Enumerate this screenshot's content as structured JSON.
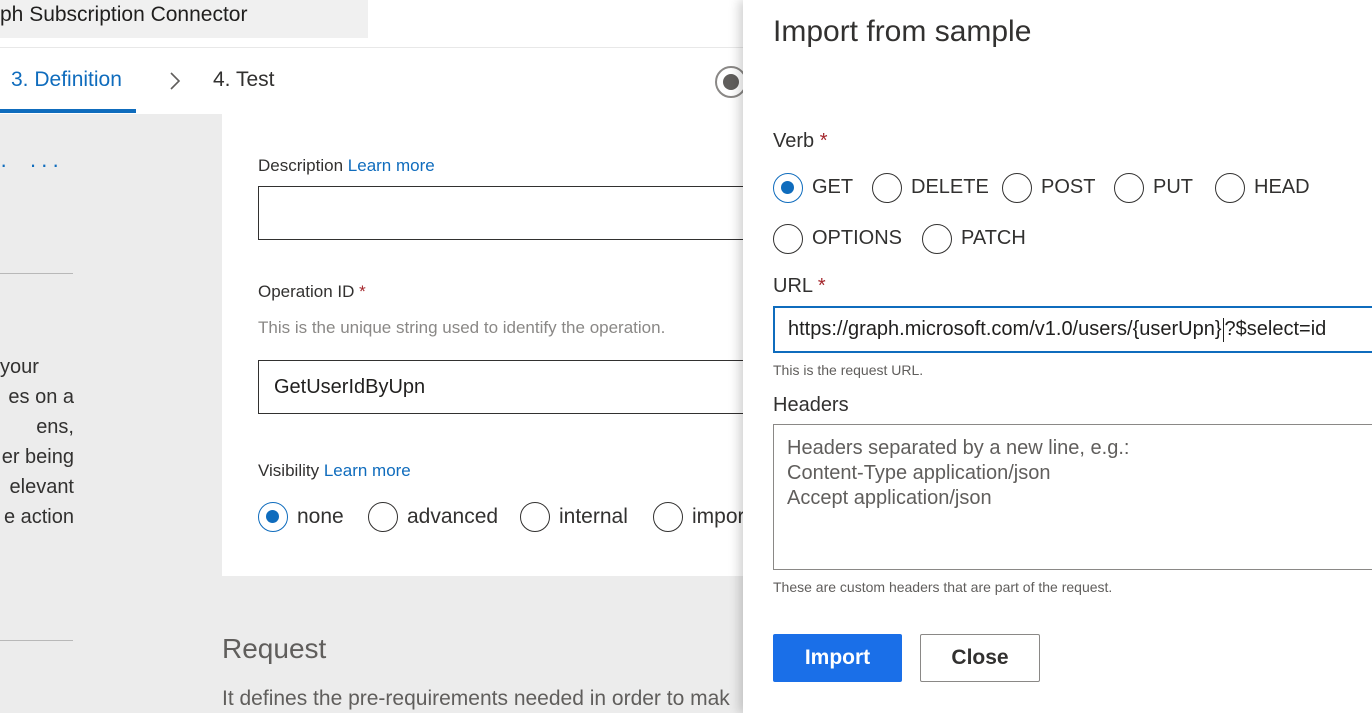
{
  "editor": {
    "title": "ph Subscription Connector",
    "steps": {
      "definition": "3. Definition",
      "test": "4. Test"
    },
    "more_dots_1": "·",
    "more_dots_2": "···",
    "summary_lines": [
      "your",
      "es on a",
      "ens,",
      "er being",
      "elevant",
      "e action"
    ],
    "description": {
      "label": "Description",
      "link": "Learn more",
      "value": ""
    },
    "operation_id": {
      "label": "Operation ID",
      "required_mark": "*",
      "hint": "This is the unique string used to identify the operation.",
      "value": "GetUserIdByUpn"
    },
    "visibility": {
      "label": "Visibility",
      "link": "Learn more",
      "options": [
        "none",
        "advanced",
        "internal",
        "impor"
      ],
      "selected": "none"
    },
    "request": {
      "title": "Request",
      "description": "It defines the pre-requirements needed in order to mak"
    }
  },
  "panel": {
    "title": "Import from sample",
    "verb": {
      "label": "Verb",
      "required_mark": "*",
      "options": [
        "GET",
        "DELETE",
        "POST",
        "PUT",
        "HEAD",
        "OPTIONS",
        "PATCH"
      ],
      "selected": "GET"
    },
    "url": {
      "label": "URL",
      "required_mark": "*",
      "value_before_caret": "https://graph.microsoft.com/v1.0/users/{userUpn}",
      "value_after_caret": "?$select=id",
      "help": "This is the request URL."
    },
    "headers": {
      "label": "Headers",
      "placeholder": "Headers separated by a new line, e.g.:\nContent-Type application/json\nAccept application/json",
      "help": "These are custom headers that are part of the request."
    },
    "buttons": {
      "import": "Import",
      "close": "Close"
    }
  },
  "colors": {
    "accent": "#0f6cbd",
    "required": "#a4262c",
    "primary_button": "#1a6fe8"
  }
}
